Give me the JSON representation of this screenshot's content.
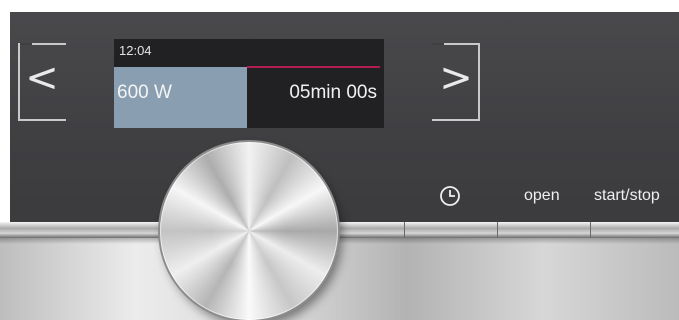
{
  "display": {
    "clock": "12:04",
    "power": "600 W",
    "duration": "05min 00s",
    "progress_fraction": 0.5
  },
  "nav": {
    "left_glyph": "<",
    "right_glyph": ">"
  },
  "controls": {
    "timer_icon": "clock-icon",
    "open_label": "open",
    "start_stop_label": "start/stop"
  },
  "colors": {
    "power_segment": "#8a9eb1",
    "progress_bar": "#b11d52",
    "display_bg": "#212123"
  }
}
